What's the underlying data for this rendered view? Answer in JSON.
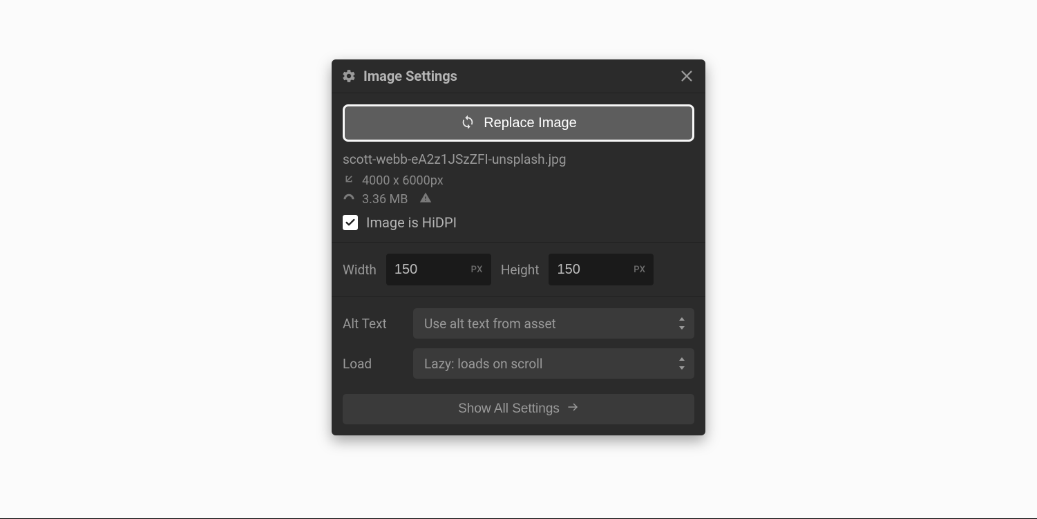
{
  "panel": {
    "title": "Image Settings"
  },
  "replace": {
    "label": "Replace Image"
  },
  "file": {
    "name": "scott-webb-eA2z1JSzZFI-unsplash.jpg",
    "dimensions": "4000 x 6000px",
    "size": "3.36 MB",
    "hidpi_label": "Image is HiDPI",
    "hidpi_checked": true
  },
  "size": {
    "width_label": "Width",
    "width_value": "150",
    "height_label": "Height",
    "height_value": "150",
    "unit": "PX"
  },
  "alt": {
    "label": "Alt Text",
    "value": "Use alt text from asset"
  },
  "load": {
    "label": "Load",
    "value": "Lazy: loads on scroll"
  },
  "show_all": {
    "label": "Show All Settings"
  }
}
